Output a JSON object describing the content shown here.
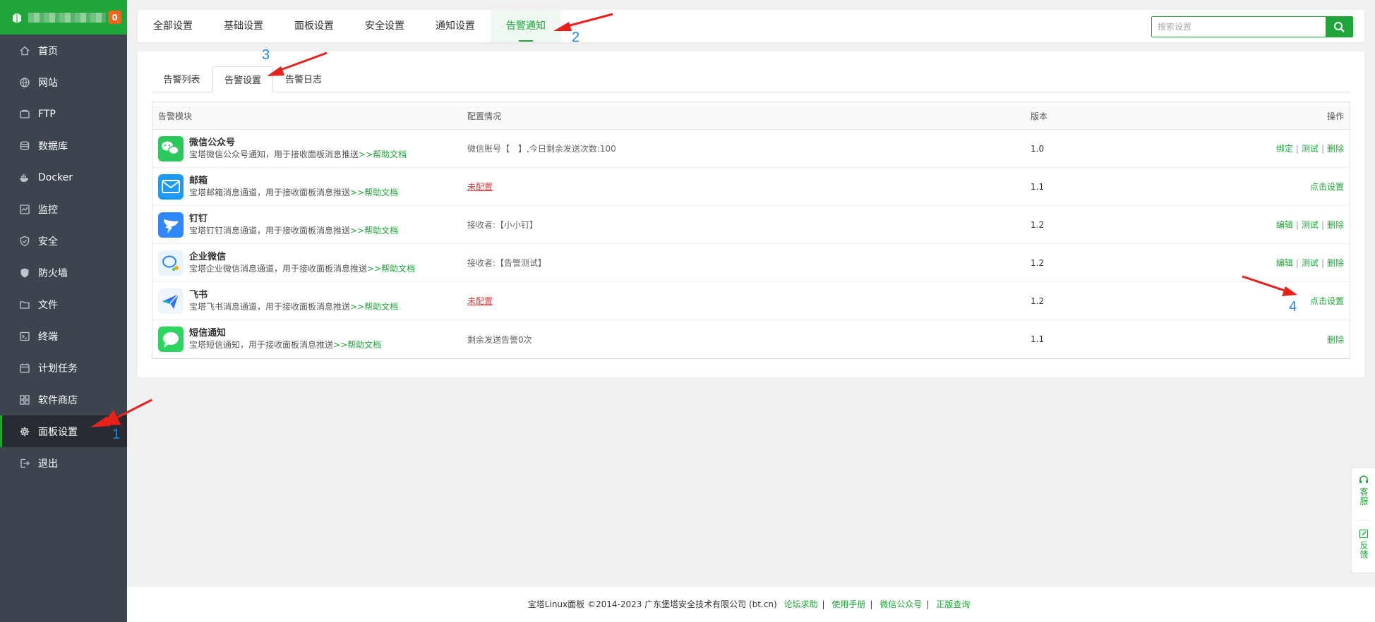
{
  "sidebar": {
    "badge": "0",
    "items": [
      {
        "label": "首页",
        "icon": "home-icon"
      },
      {
        "label": "网站",
        "icon": "globe-icon"
      },
      {
        "label": "FTP",
        "icon": "ftp-icon"
      },
      {
        "label": "数据库",
        "icon": "database-icon"
      },
      {
        "label": "Docker",
        "icon": "docker-icon"
      },
      {
        "label": "监控",
        "icon": "monitor-icon"
      },
      {
        "label": "安全",
        "icon": "shield-icon"
      },
      {
        "label": "防火墙",
        "icon": "firewall-icon"
      },
      {
        "label": "文件",
        "icon": "folder-icon"
      },
      {
        "label": "终端",
        "icon": "terminal-icon"
      },
      {
        "label": "计划任务",
        "icon": "calendar-icon"
      },
      {
        "label": "软件商店",
        "icon": "apps-icon"
      },
      {
        "label": "面板设置",
        "icon": "gear-icon",
        "active": true
      },
      {
        "label": "退出",
        "icon": "logout-icon"
      }
    ]
  },
  "top_tabs": [
    {
      "label": "全部设置"
    },
    {
      "label": "基础设置"
    },
    {
      "label": "面板设置"
    },
    {
      "label": "安全设置"
    },
    {
      "label": "通知设置"
    },
    {
      "label": "告警通知",
      "active": true
    }
  ],
  "search": {
    "placeholder": "搜索设置"
  },
  "sub_tabs": [
    {
      "label": "告警列表"
    },
    {
      "label": "告警设置",
      "active": true
    },
    {
      "label": "告警日志"
    }
  ],
  "table": {
    "headers": {
      "module": "告警模块",
      "config": "配置情况",
      "version": "版本",
      "action": "操作"
    },
    "rows": [
      {
        "title": "微信公众号",
        "desc": "宝塔微信公众号通知，用于接收面板消息推送",
        "help": ">>帮助文档",
        "config": "微信账号【　】,今日剩余发送次数:100",
        "config_warn": false,
        "version": "1.0",
        "actions": [
          "绑定",
          "测试",
          "删除"
        ],
        "icon": "wechat-official-icon",
        "color": "#2bc95b"
      },
      {
        "title": "邮箱",
        "desc": "宝塔邮箱消息通道，用于接收面板消息推送",
        "help": ">>帮助文档",
        "config": "未配置",
        "config_warn": true,
        "version": "1.1",
        "actions": [
          "点击设置"
        ],
        "icon": "mail-icon",
        "color": "#1c9af5"
      },
      {
        "title": "钉钉",
        "desc": "宝塔钉钉消息通道，用于接收面板消息推送",
        "help": ">>帮助文档",
        "config": "接收者:【小小钉】",
        "config_warn": false,
        "version": "1.2",
        "actions": [
          "编辑",
          "测试",
          "删除"
        ],
        "icon": "dingtalk-icon",
        "color": "#2f87f8"
      },
      {
        "title": "企业微信",
        "desc": "宝塔企业微信消息通道，用于接收面板消息推送",
        "help": ">>帮助文档",
        "config": "接收者:【告警测试】",
        "config_warn": false,
        "version": "1.2",
        "actions": [
          "编辑",
          "测试",
          "删除"
        ],
        "icon": "wecom-icon",
        "color": "#eaf4fd"
      },
      {
        "title": "飞书",
        "desc": "宝塔飞书消息通道，用于接收面板消息推送",
        "help": ">>帮助文档",
        "config": "未配置",
        "config_warn": true,
        "version": "1.2",
        "actions": [
          "点击设置"
        ],
        "icon": "feishu-icon",
        "color": "#eef5fb"
      },
      {
        "title": "短信通知",
        "desc": "宝塔短信通知，用于接收面板消息推送",
        "help": ">>帮助文档",
        "config": "剩余发送告警0次",
        "config_warn": false,
        "version": "1.1",
        "actions": [
          "删除"
        ],
        "icon": "sms-icon",
        "color": "#2bd560"
      }
    ]
  },
  "footer": {
    "copyright": "宝塔Linux面板 ©2014-2023 广东堡塔安全技术有限公司 (bt.cn)",
    "links": [
      "论坛求助",
      "使用手册",
      "微信公众号",
      "正版查询"
    ]
  },
  "float_widget": [
    {
      "label": "客服",
      "icon": "headset-icon"
    },
    {
      "label": "反馈",
      "icon": "edit-icon"
    }
  ],
  "annotations": {
    "numbers": [
      "1",
      "2",
      "3",
      "4"
    ],
    "color": "#1e88e5",
    "arrow_color": "#e8211c"
  },
  "colors": {
    "accent": "#20a53a",
    "sidebar": "#3c444d",
    "warn": "#e4393c"
  }
}
